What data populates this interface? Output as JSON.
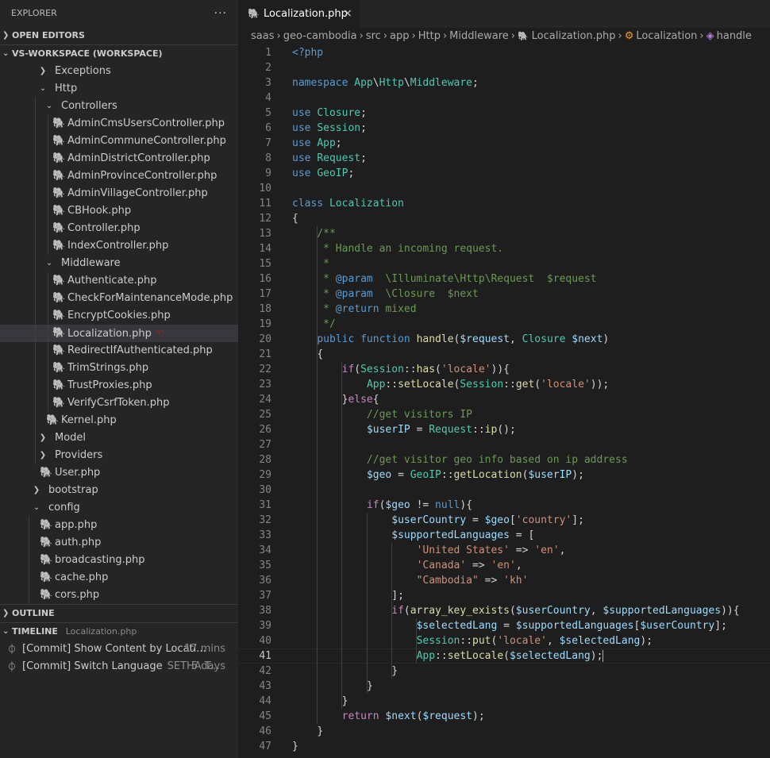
{
  "sidebar": {
    "title": "EXPLORER",
    "more_icon": "ellipsis-icon",
    "open_editors": "OPEN EDITORS",
    "workspace": "VS-WORKSPACE (WORKSPACE)",
    "tree": [
      {
        "label": "Exceptions",
        "kind": "folder",
        "expanded": false,
        "depth": 3
      },
      {
        "label": "Http",
        "kind": "folder",
        "expanded": true,
        "depth": 3
      },
      {
        "label": "Controllers",
        "kind": "folder",
        "expanded": true,
        "depth": 4
      },
      {
        "label": "AdminCmsUsersController.php",
        "kind": "php",
        "depth": 5
      },
      {
        "label": "AdminCommuneController.php",
        "kind": "php",
        "depth": 5
      },
      {
        "label": "AdminDistrictController.php",
        "kind": "php",
        "depth": 5
      },
      {
        "label": "AdminProvinceController.php",
        "kind": "php",
        "depth": 5
      },
      {
        "label": "AdminVillageController.php",
        "kind": "php",
        "depth": 5
      },
      {
        "label": "CBHook.php",
        "kind": "php",
        "depth": 5
      },
      {
        "label": "Controller.php",
        "kind": "php",
        "depth": 5
      },
      {
        "label": "IndexController.php",
        "kind": "php",
        "depth": 5
      },
      {
        "label": "Middleware",
        "kind": "folder",
        "expanded": true,
        "depth": 4
      },
      {
        "label": "Authenticate.php",
        "kind": "php",
        "depth": 5
      },
      {
        "label": "CheckForMaintenanceMode.php",
        "kind": "php",
        "depth": 5
      },
      {
        "label": "EncryptCookies.php",
        "kind": "php",
        "depth": 5
      },
      {
        "label": "Localization.php",
        "kind": "php",
        "depth": 5,
        "active": true
      },
      {
        "label": "RedirectIfAuthenticated.php",
        "kind": "php",
        "depth": 5
      },
      {
        "label": "TrimStrings.php",
        "kind": "php",
        "depth": 5
      },
      {
        "label": "TrustProxies.php",
        "kind": "php",
        "depth": 5
      },
      {
        "label": "VerifyCsrfToken.php",
        "kind": "php",
        "depth": 5
      },
      {
        "label": "Kernel.php",
        "kind": "php",
        "depth": 4
      },
      {
        "label": "Model",
        "kind": "folder",
        "expanded": false,
        "depth": 3
      },
      {
        "label": "Providers",
        "kind": "folder",
        "expanded": false,
        "depth": 3
      },
      {
        "label": "User.php",
        "kind": "php",
        "depth": 3
      },
      {
        "label": "bootstrap",
        "kind": "folder",
        "expanded": false,
        "depth": 2
      },
      {
        "label": "config",
        "kind": "folder",
        "expanded": true,
        "depth": 2
      },
      {
        "label": "app.php",
        "kind": "php",
        "depth": 3
      },
      {
        "label": "auth.php",
        "kind": "php",
        "depth": 3
      },
      {
        "label": "broadcasting.php",
        "kind": "php",
        "depth": 3
      },
      {
        "label": "cache.php",
        "kind": "php",
        "depth": 3
      },
      {
        "label": "cors.php",
        "kind": "php",
        "depth": 3
      }
    ],
    "outline": "OUTLINE",
    "timeline": "TIMELINE",
    "timeline_file": "Localization.php",
    "timeline_items": [
      {
        "label": "[Commit] Show Content by Locati...",
        "sub": "",
        "time": "17 mins"
      },
      {
        "label": "[Commit] Switch Language",
        "sub": "SETHA T...",
        "time": "5 days"
      }
    ]
  },
  "editor": {
    "tab_label": "Localization.php",
    "tab_close": "×",
    "breadcrumbs": [
      "saas",
      "geo-cambodia",
      "src",
      "app",
      "Http",
      "Middleware",
      "Localization.php",
      "Localization",
      "handle"
    ],
    "current_line": 41,
    "lines": [
      {
        "n": "1",
        "t": "<?php"
      },
      {
        "n": "2",
        "t": ""
      },
      {
        "n": "3",
        "t": "namespace App\\Http\\Middleware;"
      },
      {
        "n": "4",
        "t": ""
      },
      {
        "n": "5",
        "t": "use Closure;"
      },
      {
        "n": "6",
        "t": "use Session;"
      },
      {
        "n": "7",
        "t": "use App;"
      },
      {
        "n": "8",
        "t": "use Request;"
      },
      {
        "n": "9",
        "t": "use GeoIP;"
      },
      {
        "n": "10",
        "t": ""
      },
      {
        "n": "11",
        "t": "class Localization"
      },
      {
        "n": "12",
        "t": "{"
      },
      {
        "n": "13",
        "t": "    /**"
      },
      {
        "n": "14",
        "t": "     * Handle an incoming request."
      },
      {
        "n": "15",
        "t": "     *"
      },
      {
        "n": "16",
        "t": "     * @param  \\Illuminate\\Http\\Request  $request"
      },
      {
        "n": "17",
        "t": "     * @param  \\Closure  $next"
      },
      {
        "n": "18",
        "t": "     * @return mixed"
      },
      {
        "n": "19",
        "t": "     */"
      },
      {
        "n": "20",
        "t": "    public function handle($request, Closure $next)"
      },
      {
        "n": "21",
        "t": "    {"
      },
      {
        "n": "22",
        "t": "        if(Session::has('locale')){"
      },
      {
        "n": "23",
        "t": "            App::setLocale(Session::get('locale'));"
      },
      {
        "n": "24",
        "t": "        }else{"
      },
      {
        "n": "25",
        "t": "            //get visitors IP"
      },
      {
        "n": "26",
        "t": "            $userIP = Request::ip();"
      },
      {
        "n": "27",
        "t": ""
      },
      {
        "n": "28",
        "t": "            //get visitor geo info based on ip address"
      },
      {
        "n": "29",
        "t": "            $geo = GeoIP::getLocation($userIP);"
      },
      {
        "n": "30",
        "t": ""
      },
      {
        "n": "31",
        "t": "            if($geo != null){"
      },
      {
        "n": "32",
        "t": "                $userCountry = $geo['country'];"
      },
      {
        "n": "33",
        "t": "                $supportedLanguages = ["
      },
      {
        "n": "34",
        "t": "                    'United States' => 'en',"
      },
      {
        "n": "35",
        "t": "                    'Canada' => 'en',"
      },
      {
        "n": "36",
        "t": "                    \"Cambodia\" => 'kh'"
      },
      {
        "n": "37",
        "t": "                ];"
      },
      {
        "n": "38",
        "t": "                if(array_key_exists($userCountry, $supportedLanguages)){"
      },
      {
        "n": "39",
        "t": "                    $selectedLang = $supportedLanguages[$userCountry];"
      },
      {
        "n": "40",
        "t": "                    Session::put('locale', $selectedLang);"
      },
      {
        "n": "41",
        "t": "                    App::setLocale($selectedLang);"
      },
      {
        "n": "42",
        "t": "                }"
      },
      {
        "n": "43",
        "t": "            }"
      },
      {
        "n": "44",
        "t": "        }"
      },
      {
        "n": "45",
        "t": "        return $next($request);"
      },
      {
        "n": "46",
        "t": "    }"
      },
      {
        "n": "47",
        "t": "}"
      }
    ]
  },
  "colors": {
    "editor_bg": "#1e1e1e",
    "sidebar_bg": "#252526",
    "keyword": "#569cd6",
    "control": "#c586c0",
    "class": "#4ec9b0",
    "function": "#dcdcaa",
    "variable": "#9cdcfe",
    "string": "#ce9178",
    "comment": "#6a9955",
    "php_icon": "#a074c4"
  }
}
